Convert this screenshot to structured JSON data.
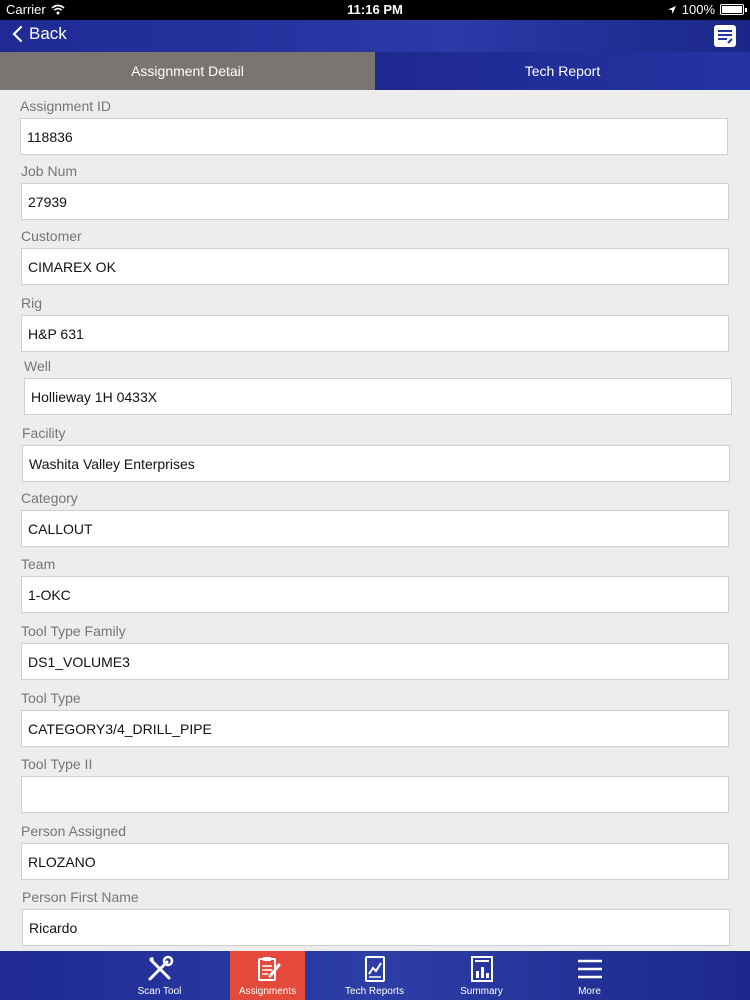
{
  "status_bar": {
    "carrier": "Carrier",
    "time": "11:16 PM",
    "battery": "100%"
  },
  "nav": {
    "back_label": "Back"
  },
  "tabs": [
    {
      "label": "Assignment Detail",
      "active": true
    },
    {
      "label": "Tech Report",
      "active": false
    }
  ],
  "fields": [
    {
      "label": "Assignment ID",
      "value": "118836"
    },
    {
      "label": "Job Num",
      "value": "27939"
    },
    {
      "label": "Customer",
      "value": "CIMAREX OK"
    },
    {
      "label": "Rig",
      "value": "H&P 631"
    },
    {
      "label": "Well",
      "value": "Hollieway 1H 0433X"
    },
    {
      "label": "Facility",
      "value": "Washita Valley Enterprises"
    },
    {
      "label": "Category",
      "value": "CALLOUT"
    },
    {
      "label": "Team",
      "value": "1-OKC"
    },
    {
      "label": "Tool Type Family",
      "value": "DS1_VOLUME3"
    },
    {
      "label": "Tool Type",
      "value": "CATEGORY3/4_DRILL_PIPE"
    },
    {
      "label": "Tool Type II",
      "value": ""
    },
    {
      "label": "Person Assigned",
      "value": "RLOZANO"
    },
    {
      "label": "Person First Name",
      "value": "Ricardo"
    }
  ],
  "tab_bar": {
    "items": [
      {
        "label": "Scan Tool",
        "icon": "wrench-screwdriver-icon"
      },
      {
        "label": "Assignments",
        "icon": "clipboard-pencil-icon",
        "active": true
      },
      {
        "label": "Tech Reports",
        "icon": "chart-document-icon"
      },
      {
        "label": "Summary",
        "icon": "summary-chart-icon"
      },
      {
        "label": "More",
        "icon": "hamburger-icon"
      }
    ]
  },
  "colors": {
    "nav_blue": "#2434a0",
    "active_tab_gray": "#7a7570",
    "active_tabbar_red": "#e34a3c",
    "page_bg": "#ededed"
  }
}
